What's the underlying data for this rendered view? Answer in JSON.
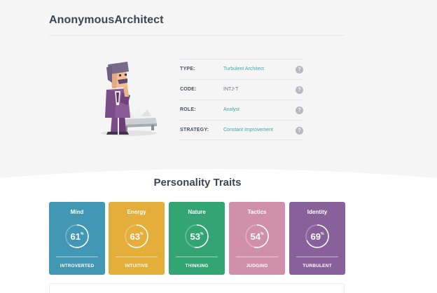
{
  "profile": {
    "username": "AnonymousArchitect",
    "avatar_icon": "architect-character-icon",
    "info": [
      {
        "label": "TYPE:",
        "value": "Turbulent Architect",
        "help": "?",
        "accent": true
      },
      {
        "label": "CODE:",
        "value": "INTJ-T",
        "help": "?",
        "accent": false
      },
      {
        "label": "ROLE:",
        "value": "Analyst",
        "help": "?",
        "accent": true
      },
      {
        "label": "STRATEGY:",
        "value": "Constant Improvement",
        "help": "?",
        "accent": true
      }
    ]
  },
  "traits": {
    "title": "Personality Traits",
    "percent_sign": "%",
    "cards": [
      {
        "name": "Mind",
        "percent": 61,
        "trait": "INTROVERTED",
        "color": "#4298b4"
      },
      {
        "name": "Energy",
        "percent": 63,
        "trait": "INTUITIVE",
        "color": "#e4ae3a"
      },
      {
        "name": "Nature",
        "percent": 53,
        "trait": "THINKING",
        "color": "#33a474"
      },
      {
        "name": "Tactics",
        "percent": 54,
        "trait": "JUDGING",
        "color": "#d190aa"
      },
      {
        "name": "Identity",
        "percent": 69,
        "trait": "TURBULENT",
        "color": "#88619a"
      }
    ]
  }
}
